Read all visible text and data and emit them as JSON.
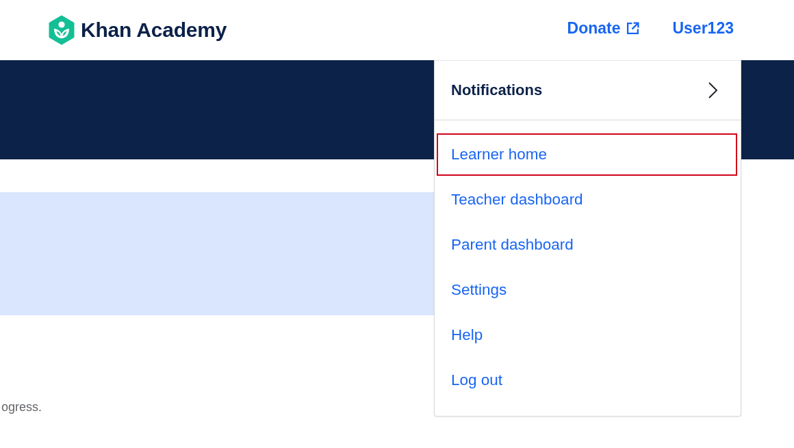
{
  "header": {
    "logo": {
      "text": "Khan Academy"
    },
    "links": [
      {
        "label": "Donate",
        "kind": "external"
      },
      {
        "label": "User123",
        "kind": "plain"
      }
    ]
  },
  "body_text": "ogress.",
  "dropdown": {
    "header": {
      "label": "Notifications"
    },
    "items": [
      {
        "label": "Learner home",
        "highlighted": true
      },
      {
        "label": "Teacher dashboard",
        "highlighted": false
      },
      {
        "label": "Parent dashboard",
        "highlighted": false
      },
      {
        "label": "Settings",
        "highlighted": false
      },
      {
        "label": "Help",
        "highlighted": false
      },
      {
        "label": "Log out",
        "highlighted": false
      }
    ]
  }
}
